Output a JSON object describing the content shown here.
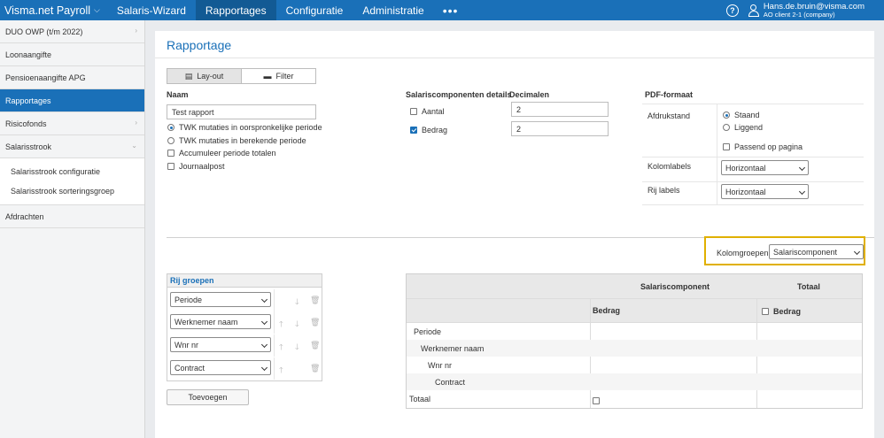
{
  "nav": {
    "brand": "Visma.net Payroll",
    "items": [
      "Salaris-Wizard",
      "Rapportages",
      "Configuratie",
      "Administratie"
    ],
    "more": "•••",
    "user_name": "Hans.de.bruin@visma.com",
    "user_client": "AO client 2-1 (company)"
  },
  "sidebar": {
    "items": [
      "DUO OWP (t/m 2022)",
      "Loonaangifte",
      "Pensioenaangifte APG",
      "Rapportages",
      "Risicofonds",
      "Salarisstrook"
    ],
    "sub_items": [
      "Salarisstrook configuratie",
      "Salarisstrook sorteringsgroep"
    ],
    "last_item": "Afdrachten"
  },
  "page": {
    "title": "Rapportage",
    "tabs": [
      "Lay-out",
      "Filter"
    ]
  },
  "form": {
    "naam_label": "Naam",
    "naam_value": "Test rapport",
    "options": [
      {
        "label": "TWK mutaties in oorspronkelijke periode",
        "type": "radio",
        "checked": true
      },
      {
        "label": "TWK mutaties in berekende periode",
        "type": "radio",
        "checked": false
      },
      {
        "label": "Accumuleer periode totalen",
        "type": "checkbox",
        "checked": false
      },
      {
        "label": "Journaalpost",
        "type": "checkbox",
        "checked": false
      }
    ],
    "salaris_label": "Salariscomponenten details",
    "decimalen_label": "Decimalen",
    "aantal_label": "Aantal",
    "aantal_decimals": "2",
    "bedrag_label": "Bedrag",
    "bedrag_decimals": "2",
    "pdf_label": "PDF-formaat",
    "afdrukstand_label": "Afdrukstand",
    "staand": "Staand",
    "liggend": "Liggend",
    "passend": "Passend op pagina",
    "kolomlabels_label": "Kolomlabels",
    "kolomlabels_value": "Horizontaal",
    "rijlabels_label": "Rij labels",
    "rijlabels_value": "Horizontaal"
  },
  "kolomgroepen": {
    "label": "Kolomgroepen",
    "value": "Salariscomponent"
  },
  "rij_groepen": {
    "title": "Rij groepen",
    "rows": [
      "Periode",
      "Werknemer naam",
      "Wnr nr",
      "Contract"
    ],
    "add_button": "Toevoegen"
  },
  "preview": {
    "col_group": "Salariscomponent",
    "totaal": "Totaal",
    "bedrag": "Bedrag",
    "bedrag_totaal": "Bedrag",
    "rows": [
      "Periode",
      "Werknemer naam",
      "Wnr nr",
      "Contract"
    ],
    "total_row": "Totaal"
  },
  "colors": {
    "accent": "#1a70b8",
    "highlight": "#e0b000"
  }
}
